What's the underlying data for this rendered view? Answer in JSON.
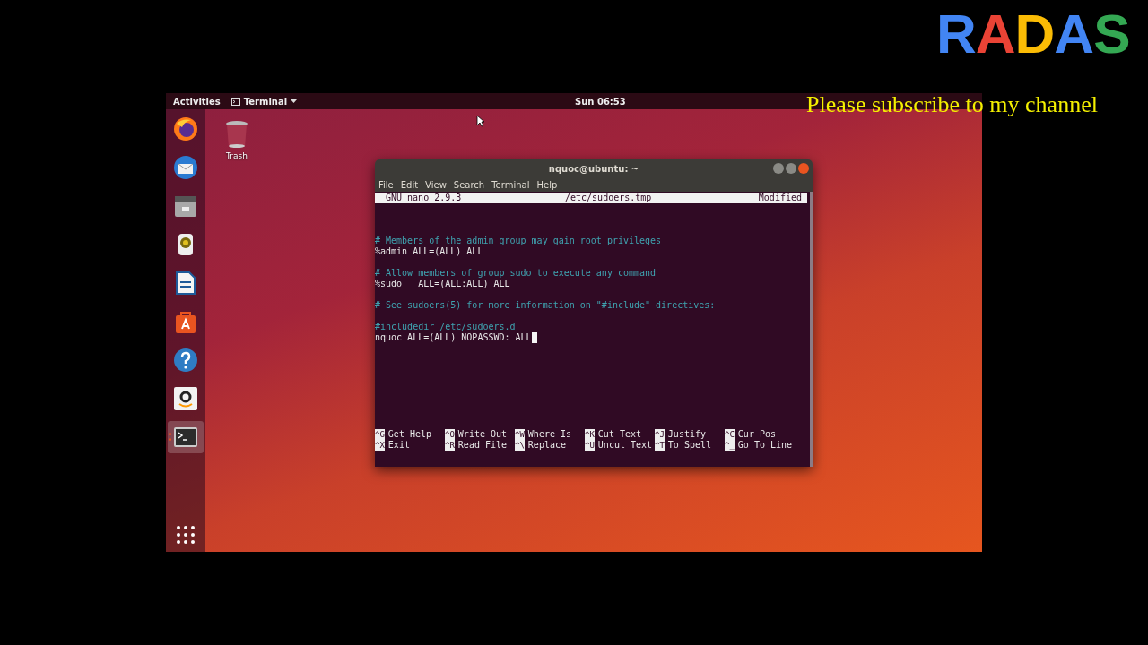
{
  "video_overlay": {
    "logo": "RADAS",
    "caption": "Please subscribe to my channel"
  },
  "top_bar": {
    "activities": "Activities",
    "app_menu": "Terminal",
    "clock": "Sun 06:53"
  },
  "dock": {
    "items": [
      {
        "kind": "firefox",
        "running": false
      },
      {
        "kind": "mail",
        "running": false
      },
      {
        "kind": "files",
        "running": false
      },
      {
        "kind": "music",
        "running": false
      },
      {
        "kind": "writer",
        "running": false
      },
      {
        "kind": "store",
        "running": false
      },
      {
        "kind": "help",
        "running": false
      },
      {
        "kind": "amazon",
        "running": false
      },
      {
        "kind": "terminal",
        "running": true
      }
    ]
  },
  "desktop_icons": [
    {
      "label": "Trash"
    }
  ],
  "terminal": {
    "title": "nquoc@ubuntu: ~",
    "menu": [
      "File",
      "Edit",
      "View",
      "Search",
      "Terminal",
      "Help"
    ],
    "nano": {
      "version": "GNU nano 2.9.3",
      "file": "/etc/sudoers.tmp",
      "status": "Modified",
      "lines": [
        {
          "kind": "blank",
          "cursor": false
        },
        {
          "kind": "blank",
          "cursor": false
        },
        {
          "kind": "comment",
          "text": "# Members of the admin group may gain root privileges",
          "cursor": false
        },
        {
          "kind": "code",
          "text": "%admin ALL=(ALL) ALL",
          "cursor": false
        },
        {
          "kind": "blank",
          "cursor": false
        },
        {
          "kind": "comment",
          "text": "# Allow members of group sudo to execute any command",
          "cursor": false
        },
        {
          "kind": "code",
          "text": "%sudo   ALL=(ALL:ALL) ALL",
          "cursor": false
        },
        {
          "kind": "blank",
          "cursor": false
        },
        {
          "kind": "comment",
          "text": "# See sudoers(5) for more information on \"#include\" directives:",
          "cursor": false
        },
        {
          "kind": "blank",
          "cursor": false
        },
        {
          "kind": "comment",
          "text": "#includedir /etc/sudoers.d",
          "cursor": false
        },
        {
          "kind": "code",
          "text": "nquoc ALL=(ALL) NOPASSWD: ALL",
          "cursor": true
        }
      ],
      "shortcuts": [
        {
          "key": "^G",
          "label": "Get Help"
        },
        {
          "key": "^O",
          "label": "Write Out"
        },
        {
          "key": "^W",
          "label": "Where Is"
        },
        {
          "key": "^K",
          "label": "Cut Text"
        },
        {
          "key": "^J",
          "label": "Justify"
        },
        {
          "key": "^C",
          "label": "Cur Pos"
        },
        {
          "key": "^X",
          "label": "Exit"
        },
        {
          "key": "^R",
          "label": "Read File"
        },
        {
          "key": "^\\",
          "label": "Replace"
        },
        {
          "key": "^U",
          "label": "Uncut Text"
        },
        {
          "key": "^T",
          "label": "To Spell"
        },
        {
          "key": "^_",
          "label": "Go To Line"
        }
      ]
    }
  }
}
